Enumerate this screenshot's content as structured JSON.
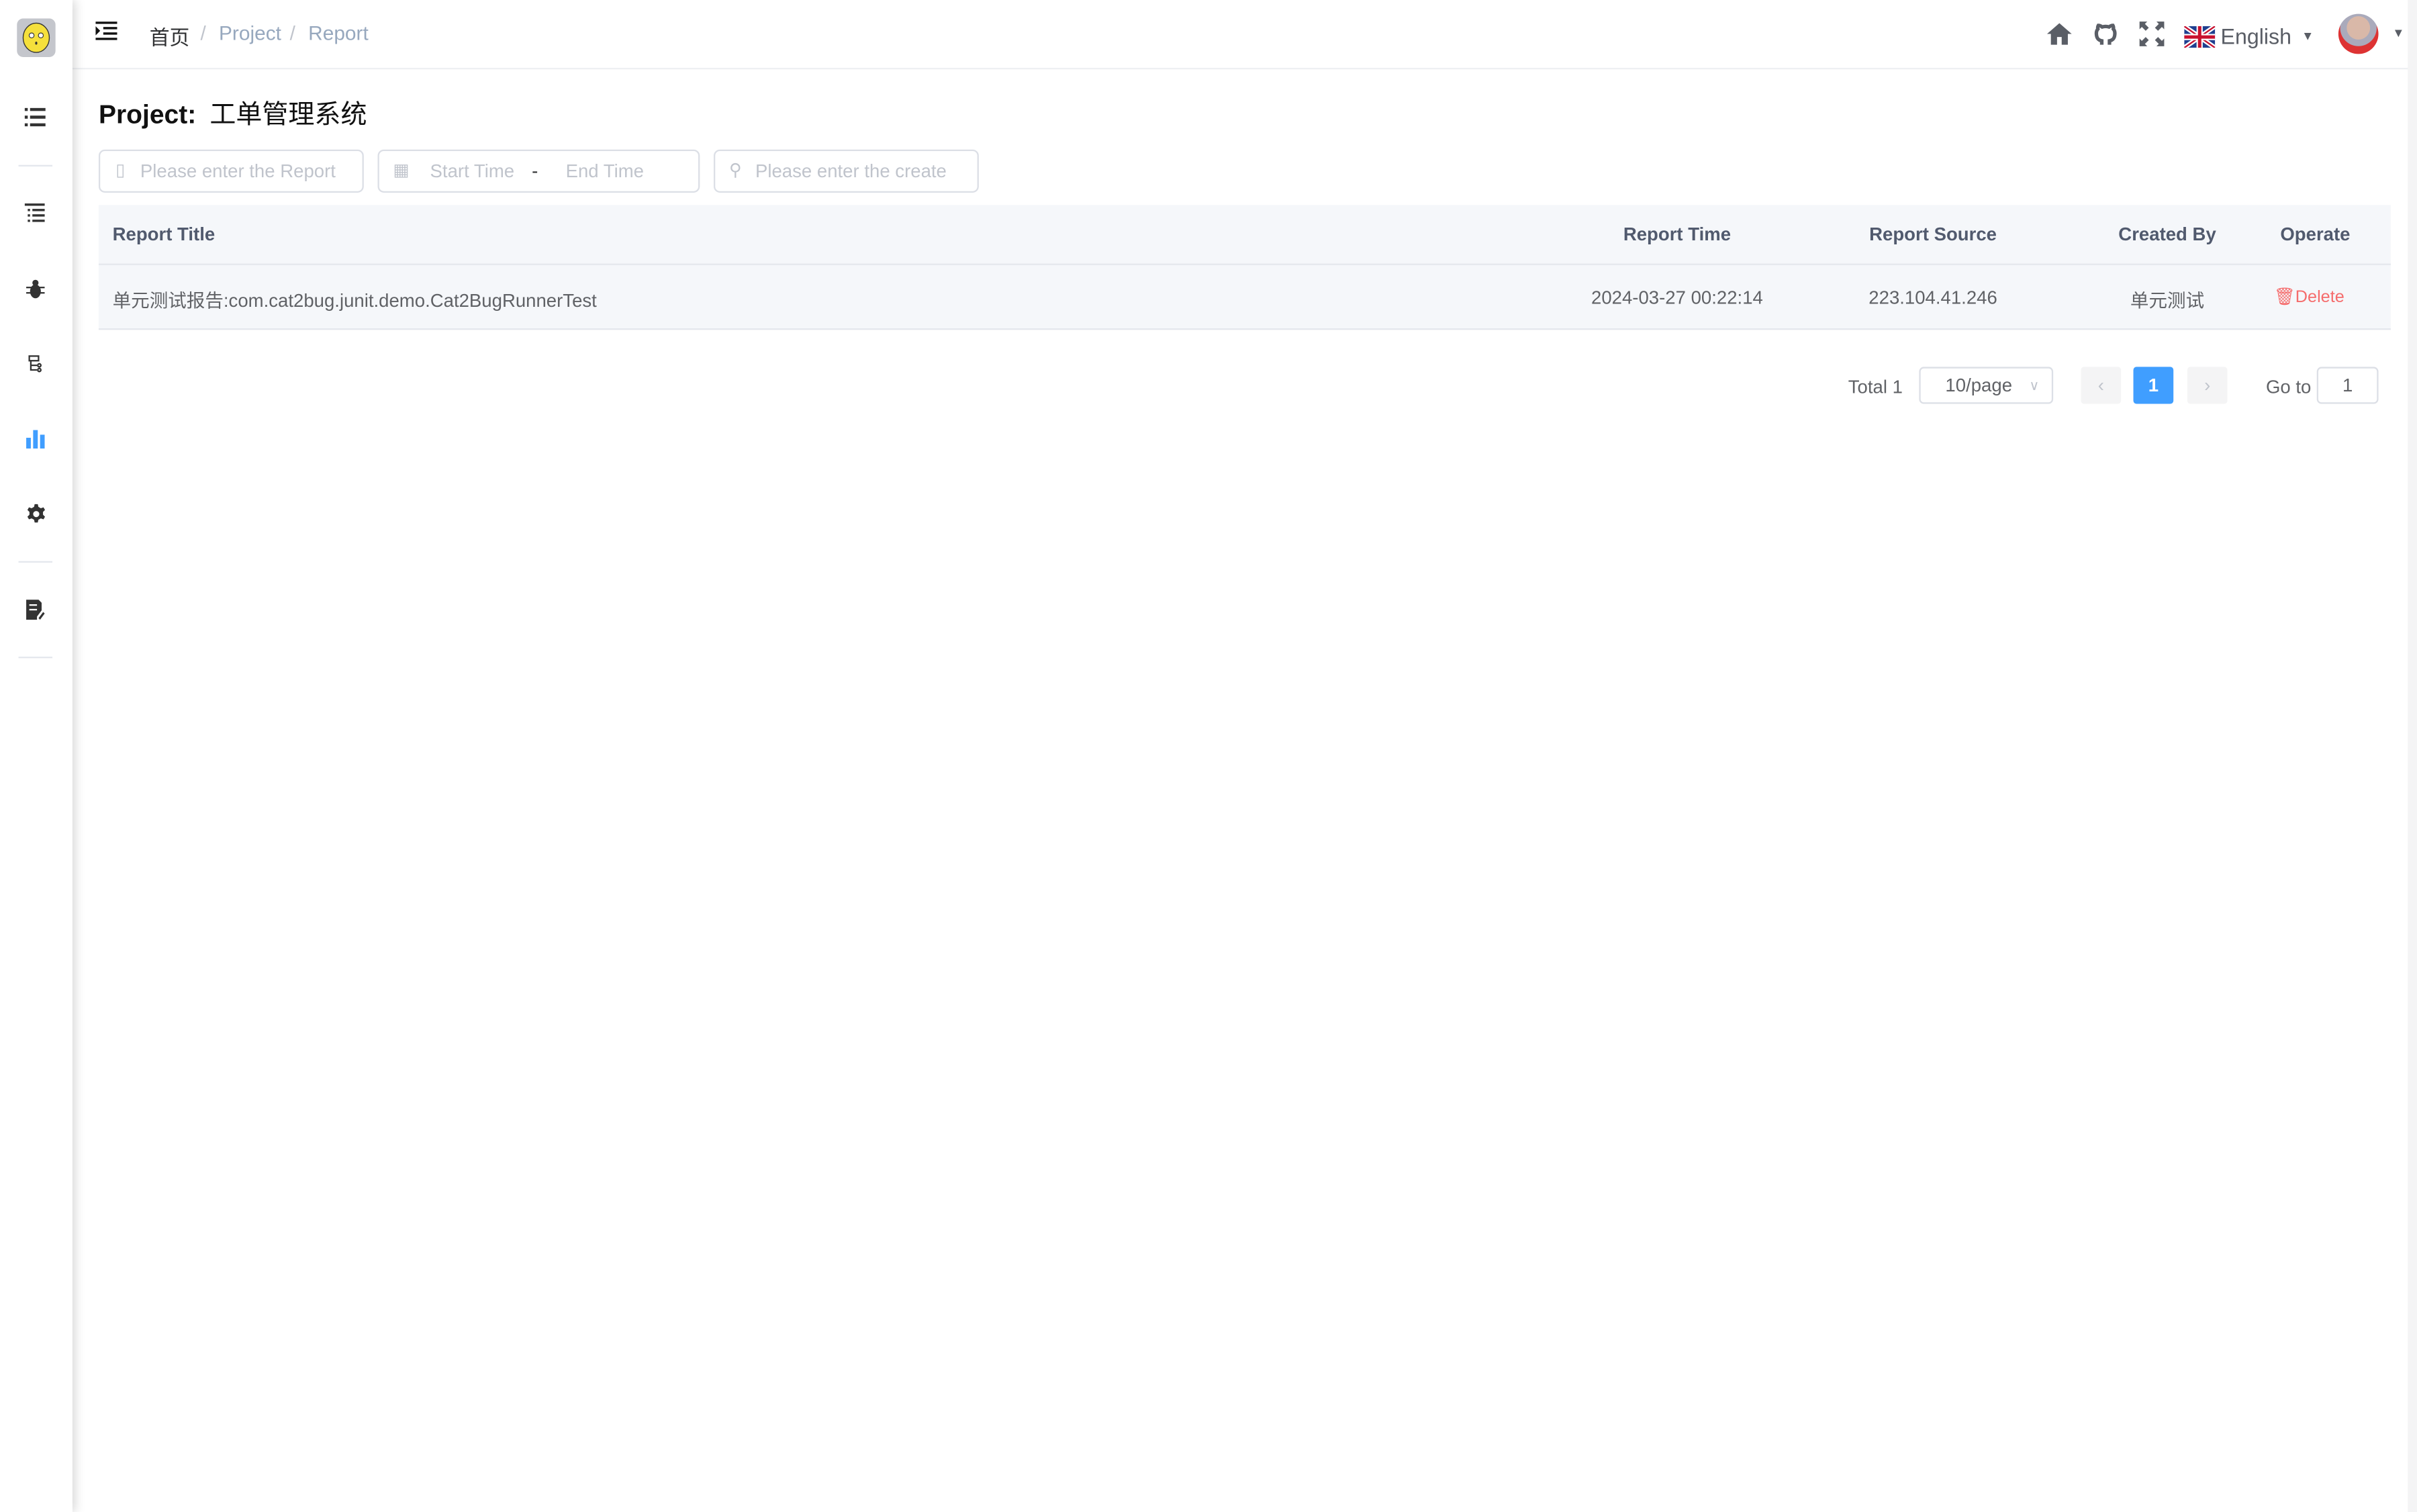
{
  "breadcrumb": [
    "首页",
    "Project",
    "Report"
  ],
  "header": {
    "language": "English",
    "icons": [
      "home-icon",
      "github-icon",
      "fullscreen-icon",
      "uk-flag-icon",
      "avatar"
    ]
  },
  "sidebar": {
    "icons": [
      "list-icon",
      "tree-list-icon",
      "bug-icon",
      "sitemap-icon",
      "bar-chart-icon",
      "gear-icon",
      "document-edit-icon"
    ],
    "active_index": 4
  },
  "page": {
    "title_label": "Project:",
    "title_value": "工单管理系统"
  },
  "filters": {
    "report_placeholder": "Please enter the Report",
    "start_placeholder": "Start Time",
    "separator": "-",
    "end_placeholder": "End Time",
    "creator_placeholder": "Please enter the create"
  },
  "table": {
    "columns": [
      "Report Title",
      "Report Time",
      "Report Source",
      "Created By",
      "Operate"
    ],
    "rows": [
      {
        "title": "单元测试报告:com.cat2bug.junit.demo.Cat2BugRunnerTest",
        "time": "2024-03-27 00:22:14",
        "source": "223.104.41.246",
        "created_by": "单元测试",
        "action": "Delete"
      }
    ]
  },
  "pagination": {
    "total": "Total 1",
    "page_size": "10/page",
    "current": "1",
    "goto_label": "Go to",
    "goto_value": "1"
  },
  "colors": {
    "accent": "#409eff",
    "danger": "#f56c6c"
  }
}
